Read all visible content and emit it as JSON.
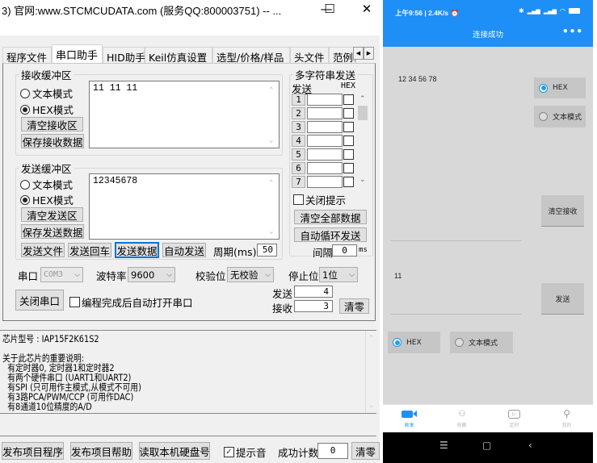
{
  "window": {
    "title": "3) 官网:www.STCMCUDATA.com  (服务QQ:800003751) -- ...",
    "minimize_icon": "—",
    "maximize_icon": "☐",
    "close_icon": "✕"
  },
  "tabs": [
    {
      "label": "程序文件",
      "active": false
    },
    {
      "label": "串口助手",
      "active": true
    },
    {
      "label": "HID助手",
      "active": false
    },
    {
      "label": "Keil仿真设置",
      "active": false
    },
    {
      "label": "选型/价格/样品",
      "active": false
    },
    {
      "label": "头文件",
      "active": false
    },
    {
      "label": "范例程",
      "active": false
    }
  ],
  "tab_scroll": {
    "left": "◀",
    "right": "▶"
  },
  "receive": {
    "legend": "接收缓冲区",
    "text_mode": "文本模式",
    "hex_mode": "HEX模式",
    "selected": "hex",
    "clear_button": "清空接收区",
    "save_button": "保存接收数据",
    "content": "11 11 11"
  },
  "send": {
    "legend": "发送缓冲区",
    "text_mode": "文本模式",
    "hex_mode": "HEX模式",
    "selected": "hex",
    "clear_button": "清空发送区",
    "save_button": "保存发送数据",
    "content": "12345678",
    "send_file": "发送文件",
    "send_enter": "发送回车",
    "send_data": "发送数据",
    "auto_send": "自动发送",
    "period_label": "周期(ms)",
    "period_value": "50"
  },
  "multi_string": {
    "legend": "多字符串发送",
    "send_header": "发送",
    "hex_header": "HEX",
    "rows": [
      "1",
      "2",
      "3",
      "4",
      "5",
      "6",
      "7"
    ],
    "close_hint": "关闭提示",
    "clear_all": "清空全部数据",
    "auto_loop": "自动循环发送",
    "interval_label": "间隔",
    "interval_value": "0",
    "interval_unit": "ms"
  },
  "port": {
    "port_label": "串口",
    "port_value": "COM3",
    "baud_label": "波特率",
    "baud_value": "9600",
    "parity_label": "校验位",
    "parity_value": "无校验",
    "stop_label": "停止位",
    "stop_value": "1位",
    "close_port": "关闭串口",
    "auto_open": "编程完成后自动打开串口",
    "sent_label": "发送",
    "sent_count": "4",
    "recv_label": "接收",
    "recv_count": "3",
    "reset_button": "清零"
  },
  "info": {
    "lines": [
      "芯片型号 : IAP15F2K61S2",
      "",
      "关于此芯片的重要说明:",
      "  有定时器0, 定时器1和定时器2",
      "  有两个硬件串口 (UART1和UART2)",
      "  有SPI (只可用作主模式,从模式不可用)",
      "  有3路PCA/PWM/CCP (可用作DAC)",
      "  有8通道10位精度的A/D"
    ]
  },
  "bottom": {
    "publish_program": "发布项目程序",
    "publish_help": "发布项目帮助",
    "read_disk": "读取本机硬盘号",
    "sound_label": "提示音",
    "sound_checked": true,
    "success_label": "成功计数",
    "success_value": "0",
    "reset_button": "清零"
  },
  "phone": {
    "status_left": "上午9:56 | 2.4K/s ⏰",
    "status_right": [
      "✱",
      "📶",
      "📶",
      "◠",
      "▭"
    ],
    "title": "连接成功",
    "more_icon": "•••",
    "received_text": "12 34 56 78",
    "recv_hex": "HEX",
    "recv_text_mode": "文本模式",
    "recv_selected": "hex",
    "clear_recv": "清空接收",
    "send_text": "11",
    "send_button": "发送",
    "send_hex": "HEX",
    "send_text_mode": "文本模式",
    "send_selected": "hex",
    "nav": [
      {
        "label": "收发",
        "icon": "video-icon",
        "active": true
      },
      {
        "label": "收藏",
        "icon": "grid-icon",
        "active": false
      },
      {
        "label": "定时",
        "icon": "play-icon",
        "active": false
      },
      {
        "label": "我的",
        "icon": "user-icon",
        "active": false
      }
    ],
    "sysnav": {
      "menu": "☰",
      "home": "▢",
      "back": "‹"
    },
    "accent": "#1e8ff6"
  }
}
